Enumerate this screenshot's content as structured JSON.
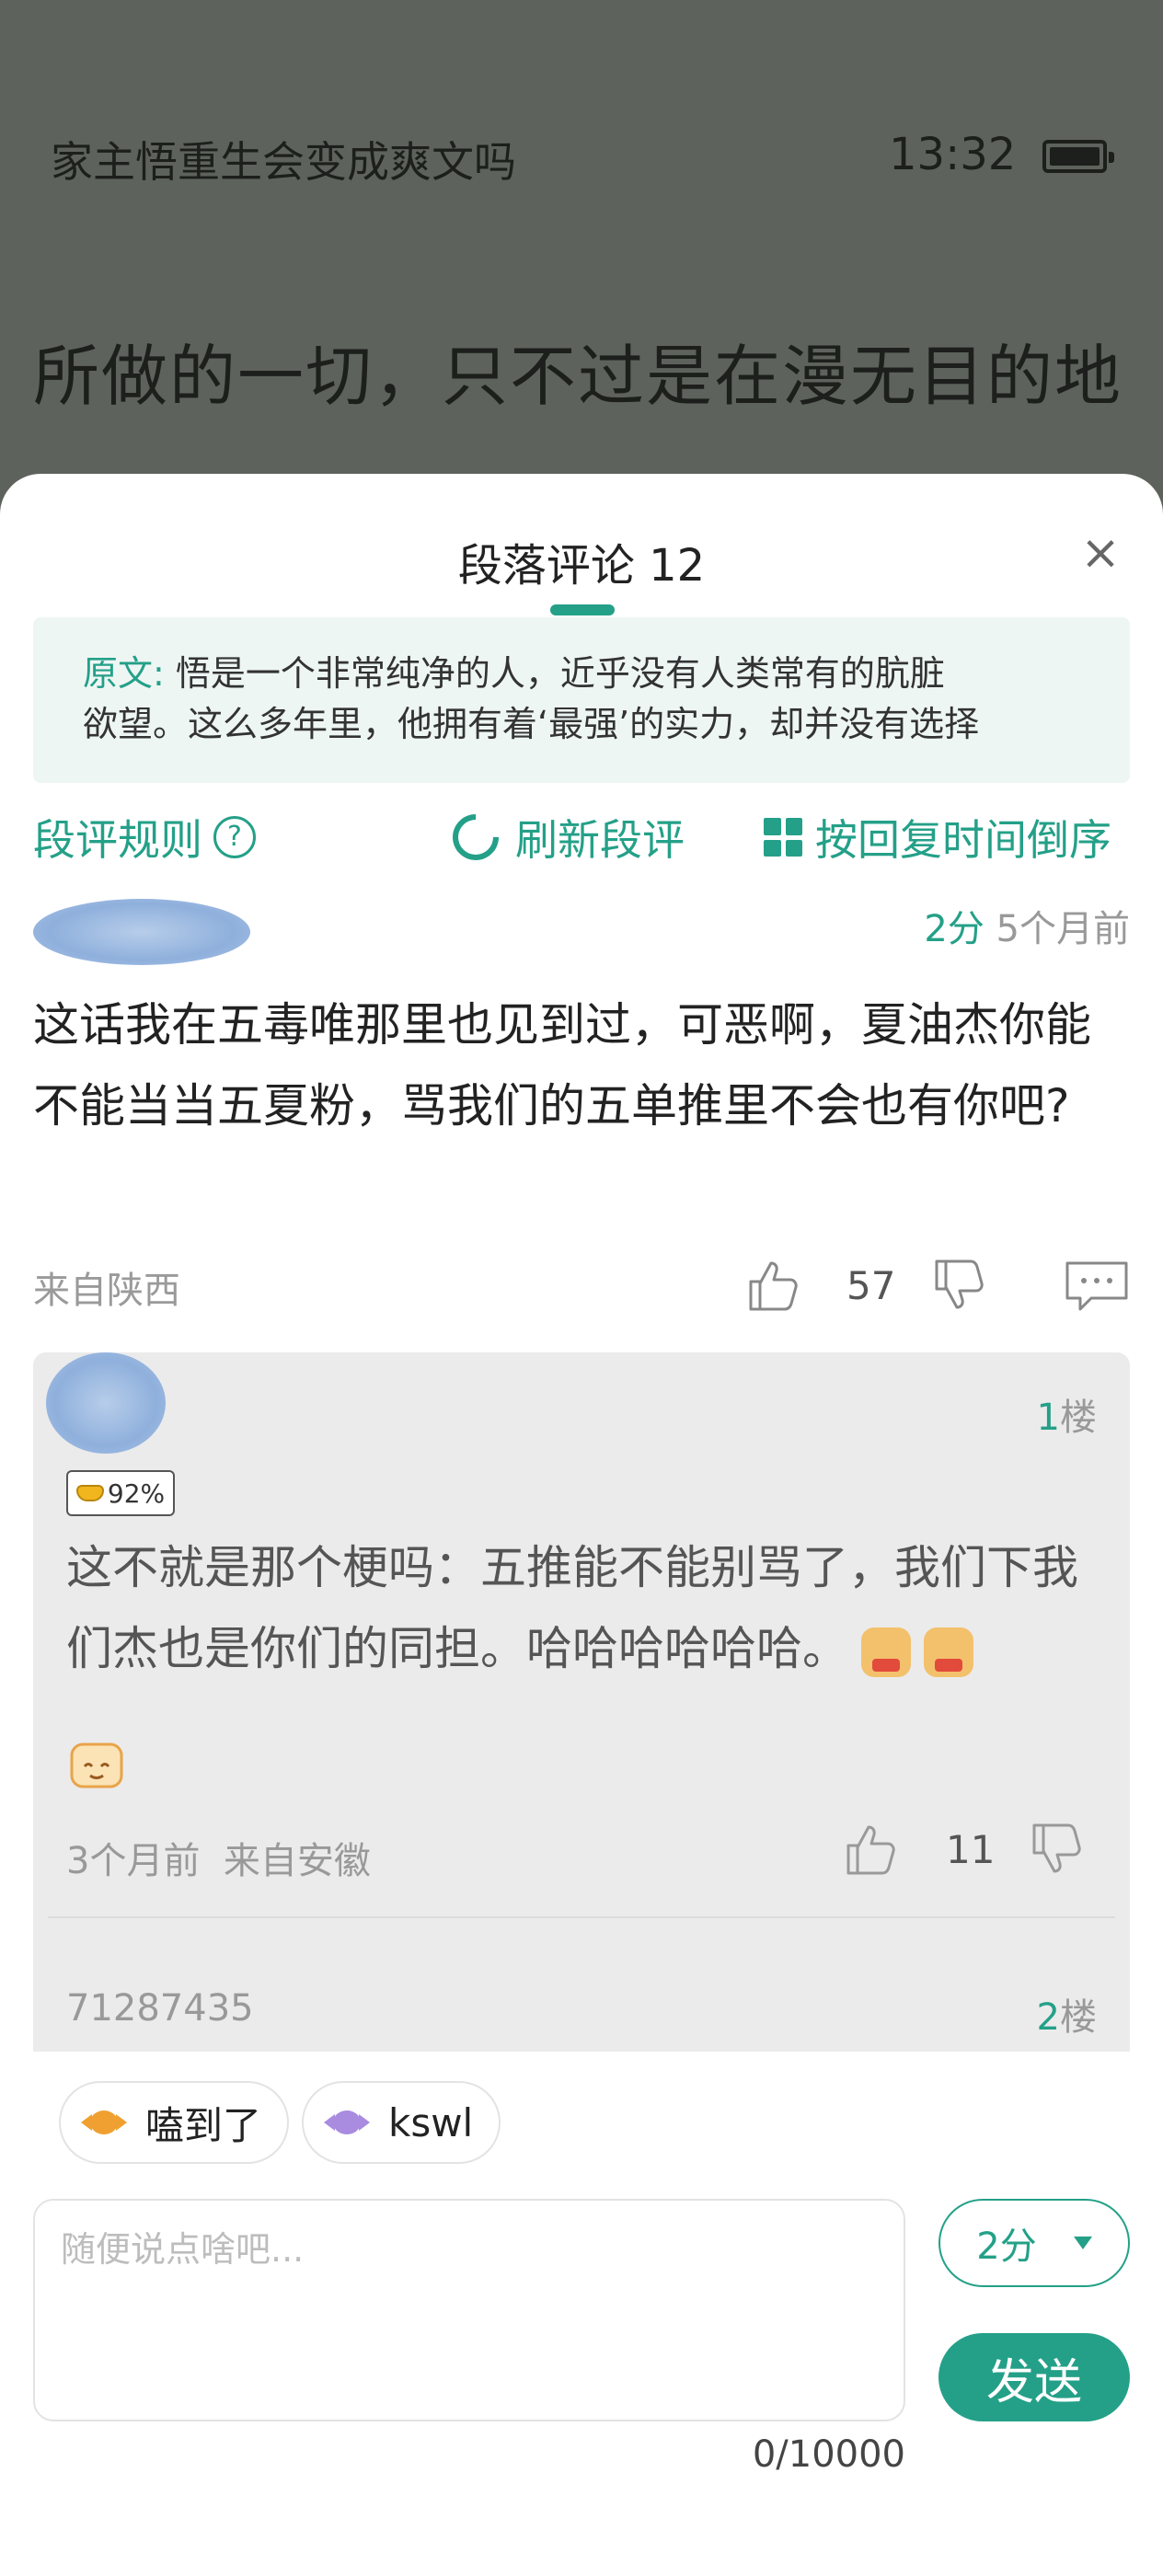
{
  "reader": {
    "book_title": "家主悟重生会变成爽文吗",
    "time": "13:32",
    "body_text": "所做的一切，只不过是在漫无目的地"
  },
  "sheet": {
    "title": "段落评论 12",
    "close_glyph": "×",
    "original": {
      "label": "原文:",
      "line1": "悟是一个非常纯净的人，近乎没有人类常有的肮脏",
      "line2": "欲望。这么多年里，他拥有着‘最强’的实力，却并没有选择"
    },
    "toolbar": {
      "rules_label": "段评规则",
      "help_glyph": "?",
      "refresh_label": "刷新段评",
      "sort_label": "按回复时间倒序"
    }
  },
  "comment": {
    "score": "2分",
    "time": "5个月前",
    "text": "这话我在五毒唯那里也见到过，可恶啊，夏油杰你能不能当当五夏粉，骂我们的五单推里不会也有你吧?",
    "location": "来自陕西",
    "likes": "57"
  },
  "reply": {
    "floor_num": "1",
    "floor_suffix": "楼",
    "badge": "92%",
    "text": "这不就是那个梗吗：五推能不能别骂了，我们下我们杰也是你们的同担。哈哈哈哈哈哈。",
    "time": "3个月前",
    "location": "来自安徽",
    "likes": "11",
    "next_user_id": "71287435",
    "next_floor_num": "2",
    "next_floor_suffix": "楼"
  },
  "chips": [
    {
      "label": "嗑到了",
      "icon": "orange-candy-icon",
      "color": "#f0a030"
    },
    {
      "label": "kswl",
      "icon": "purple-candy-icon",
      "color": "#a98be0"
    }
  ],
  "composer": {
    "placeholder": "随便说点啥吧...",
    "char_count": "0/10000",
    "score_value": "2分",
    "send_label": "发送"
  },
  "colors": {
    "accent": "#24a088",
    "dim_background": "#5e625c"
  }
}
